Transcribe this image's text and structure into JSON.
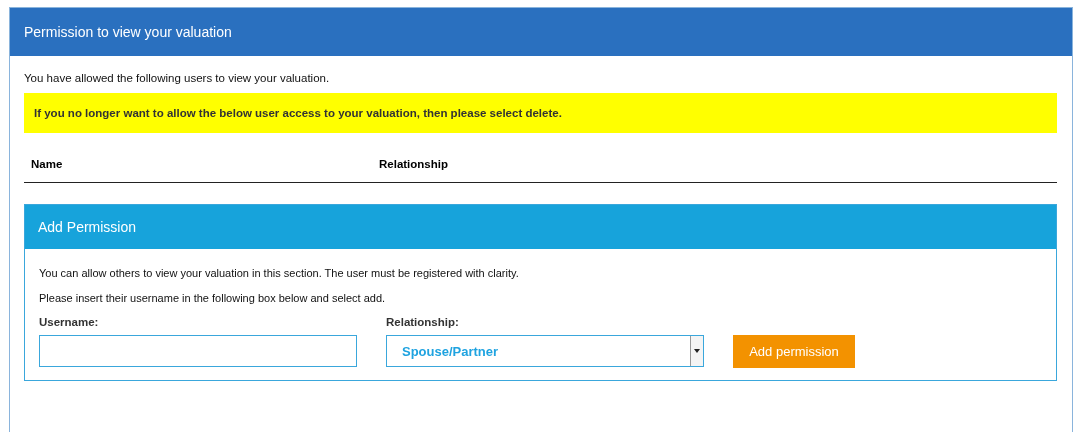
{
  "panel": {
    "title": "Permission to view your valuation",
    "intro": "You have allowed the following users to view your valuation.",
    "notice": "If you no longer want to allow the below user access to your valuation, then please select delete.",
    "table": {
      "columns": [
        "Name",
        "Relationship"
      ]
    }
  },
  "add_permission": {
    "title": "Add Permission",
    "paragraphs": [
      "You can allow others to view your valuation in this section. The user must be registered with clarity.",
      "Please insert their username in the following box below and select add."
    ],
    "username": {
      "label": "Username:"
    },
    "relationship": {
      "label": "Relationship:",
      "value": "Spouse/Partner"
    },
    "button": "Add permission"
  }
}
